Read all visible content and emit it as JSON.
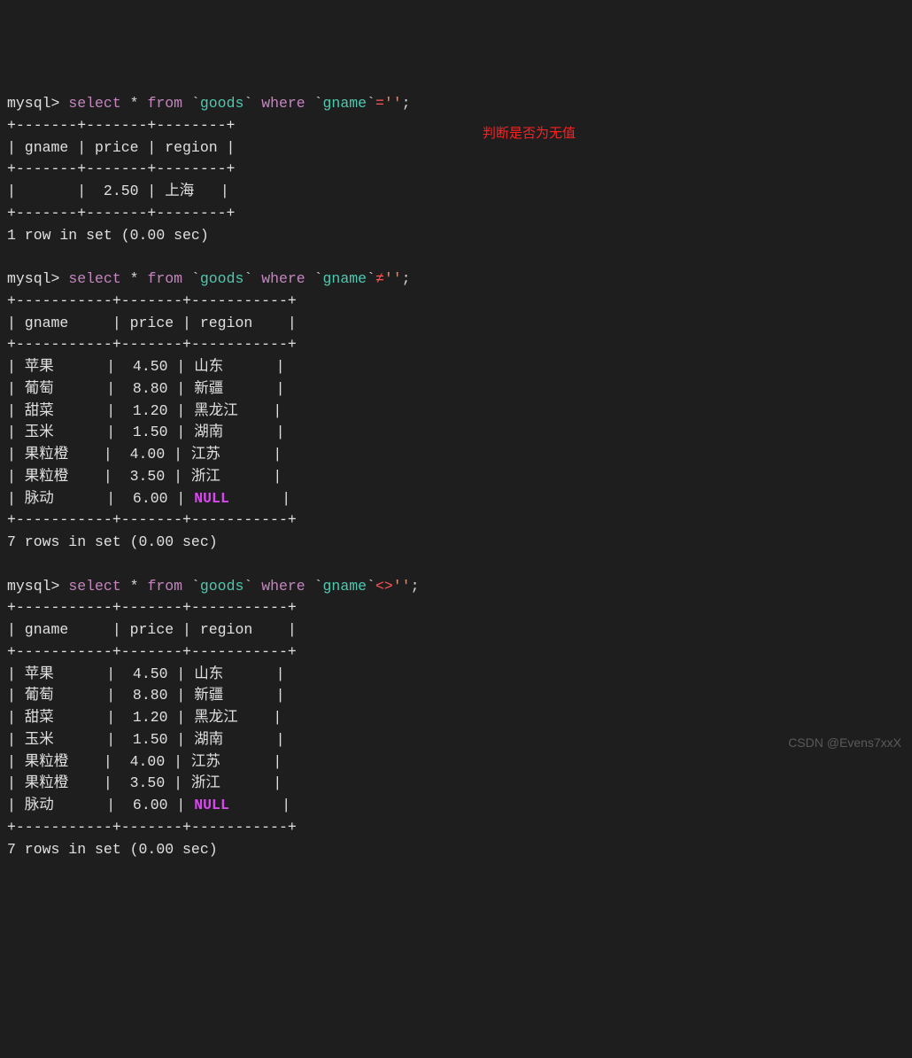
{
  "prompt": "mysql> ",
  "query1": {
    "select": "select",
    "star": "*",
    "from": "from",
    "table": "goods",
    "where": "where",
    "column": "gname",
    "op": "=",
    "val": "''",
    "semi": ";"
  },
  "table1": {
    "border_top": "+-------+-------+--------+",
    "header": "| gname | price | region |",
    "border_mid": "+-------+-------+--------+",
    "row1": "|       |  2.50 | 上海   |",
    "border_bot": "+-------+-------+--------+",
    "result": "1 row in set (0.00 sec)"
  },
  "query2": {
    "select": "select",
    "star": "*",
    "from": "from",
    "table": "goods",
    "where": "where",
    "column": "gname",
    "op": "≠",
    "val": "''",
    "semi": ";"
  },
  "table2": {
    "border_top": "+-----------+-------+-----------+",
    "header": "| gname     | price | region    |",
    "border_mid": "+-----------+-------+-----------+",
    "rows": [
      "| 苹果      |  4.50 | 山东      |",
      "| 葡萄      |  8.80 | 新疆      |",
      "| 甜菜      |  1.20 | 黑龙江    |",
      "| 玉米      |  1.50 | 湖南      |",
      "| 果粒橙    |  4.00 | 江苏      |",
      "| 果粒橙    |  3.50 | 浙江      |"
    ],
    "row_null_pre": "| 脉动      |  6.00 | ",
    "row_null_val": "NULL",
    "row_null_post": "      |",
    "border_bot": "+-----------+-------+-----------+",
    "result": "7 rows in set (0.00 sec)"
  },
  "query3": {
    "select": "select",
    "star": "*",
    "from": "from",
    "table": "goods",
    "where": "where",
    "column": "gname",
    "op": "<>",
    "val": "''",
    "semi": ";"
  },
  "table3": {
    "border_top": "+-----------+-------+-----------+",
    "header": "| gname     | price | region    |",
    "border_mid": "+-----------+-------+-----------+",
    "rows": [
      "| 苹果      |  4.50 | 山东      |",
      "| 葡萄      |  8.80 | 新疆      |",
      "| 甜菜      |  1.20 | 黑龙江    |",
      "| 玉米      |  1.50 | 湖南      |",
      "| 果粒橙    |  4.00 | 江苏      |",
      "| 果粒橙    |  3.50 | 浙江      |"
    ],
    "row_null_pre": "| 脉动      |  6.00 | ",
    "row_null_val": "NULL",
    "row_null_post": "      |",
    "border_bot": "+-----------+-------+-----------+",
    "result": "7 rows in set (0.00 sec)"
  },
  "annotation": "判断是否为无值",
  "watermark": "CSDN @Evens7xxX"
}
